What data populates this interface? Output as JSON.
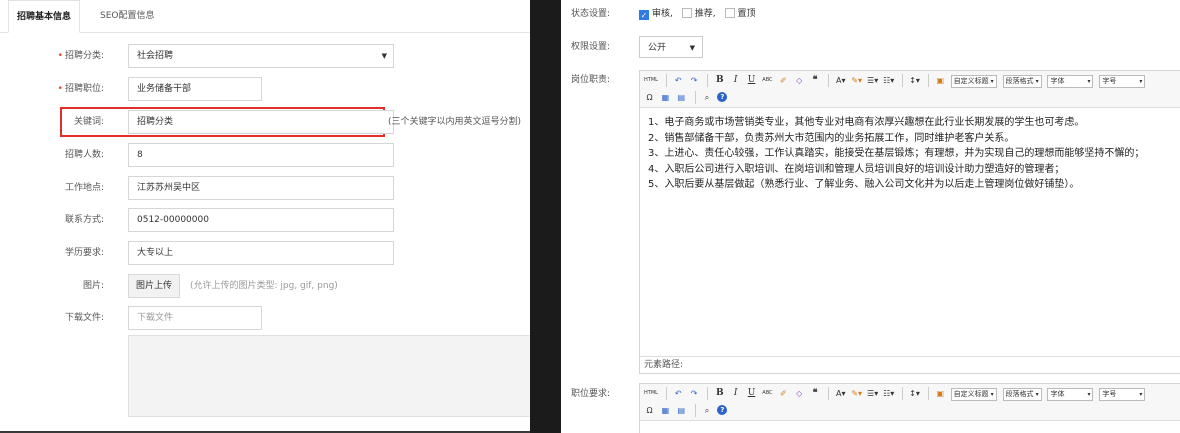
{
  "tabs": [
    {
      "label": "招聘基本信息"
    },
    {
      "label": "SEO配置信息"
    }
  ],
  "form": {
    "category": {
      "label": "招聘分类:",
      "value": "社会招聘",
      "required": true
    },
    "position": {
      "label": "招聘职位:",
      "value": "业务储备干部",
      "required": true
    },
    "keywords": {
      "label": "关键词:",
      "value": "招聘分类",
      "hint": "(三个关键字以内用英文逗号分割)"
    },
    "count": {
      "label": "招聘人数:",
      "value": "8"
    },
    "location": {
      "label": "工作地点:",
      "value": "江苏苏州吴中区"
    },
    "contact": {
      "label": "联系方式:",
      "value": "0512-00000000"
    },
    "education": {
      "label": "学历要求:",
      "value": "大专以上"
    },
    "image": {
      "label": "图片:",
      "button": "图片上传",
      "hint": "(允许上传的图片类型: jpg, gif, png)"
    },
    "download": {
      "label": "下载文件:",
      "placeholder": "下载文件"
    }
  },
  "right": {
    "status": {
      "label": "状态设置:",
      "options": [
        {
          "label": "审核,",
          "checked": true
        },
        {
          "label": "推荐,",
          "checked": false
        },
        {
          "label": "置顶",
          "checked": false
        }
      ]
    },
    "permission": {
      "label": "权限设置:",
      "value": "公开"
    },
    "duty": {
      "label": "岗位职责:"
    },
    "requirement": {
      "label": "职位要求:"
    },
    "editor": {
      "custom_title": "自定义标题",
      "paragraph": "段落格式",
      "font": "字体",
      "size": "字号",
      "path_label": "元素路径:",
      "content": [
        "1、电子商务或市场营销类专业，其他专业对电商有浓厚兴趣想在此行业长期发展的学生也可考虑。",
        "2、销售部储备干部，负责苏州大市范围内的业务拓展工作，同时维护老客户关系。",
        "3、上进心、责任心较强，工作认真踏实，能接受在基层锻炼；有理想，并为实现自己的理想而能够坚持不懈的；",
        "4、入职后公司进行入职培训、在岗培训和管理人员培训良好的培训设计助力塑造好的管理者；",
        "5、入职后要从基层做起（熟悉行业、了解业务、融入公司文化并为以后走上管理岗位做好铺垫）。"
      ]
    }
  },
  "colors": {
    "highlight": "#e0302b",
    "accent": "#2d7be3",
    "required": "#e8412a"
  }
}
